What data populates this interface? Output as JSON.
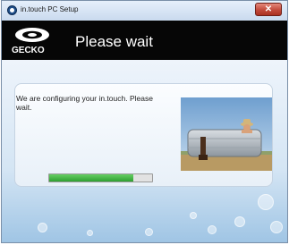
{
  "window": {
    "title": "in.touch PC Setup",
    "close_symbol": "✕"
  },
  "header": {
    "logo_text": "GECKO",
    "title": "Please wait"
  },
  "message": "We are configuring your in.touch. Please wait.",
  "progress": {
    "value_percent": 82
  },
  "photo": {
    "description_icon": "hot-tub-person-photo"
  },
  "colors": {
    "header_bg": "#060606",
    "progress_fill": "#3aab3a",
    "window_bg": "#dbe8f5"
  }
}
